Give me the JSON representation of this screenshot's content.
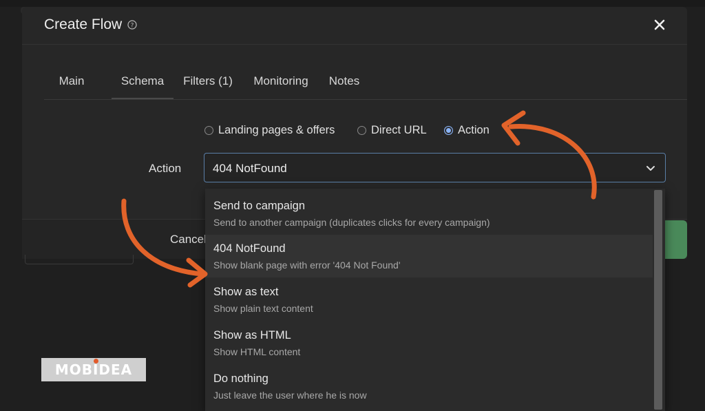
{
  "dialog": {
    "title": "Create Flow"
  },
  "tabs": [
    {
      "label": "Main"
    },
    {
      "label": "Schema"
    },
    {
      "label": "Filters (1)"
    },
    {
      "label": "Monitoring"
    },
    {
      "label": "Notes"
    }
  ],
  "active_tab": "Schema",
  "schema": {
    "radio_options": [
      {
        "label": "Landing pages & offers",
        "checked": false
      },
      {
        "label": "Direct URL",
        "checked": false
      },
      {
        "label": "Action",
        "checked": true
      }
    ],
    "action_label": "Action",
    "action_value": "404 NotFound"
  },
  "dropdown": {
    "options": [
      {
        "title": "Send to campaign",
        "desc": "Send to another campaign (duplicates clicks for every campaign)"
      },
      {
        "title": "404 NotFound",
        "desc": "Show blank page with error '404 Not Found'"
      },
      {
        "title": "Show as text",
        "desc": "Show plain text content"
      },
      {
        "title": "Show as HTML",
        "desc": "Show HTML content"
      },
      {
        "title": "Do nothing",
        "desc": "Just leave the user where he is now"
      }
    ],
    "highlighted_index": 1
  },
  "footer": {
    "cancel_label": "Cancel"
  },
  "watermark": {
    "text": "MOBIDEA"
  },
  "colors": {
    "accent": "#8ab4f8",
    "arrow": "#e2632a",
    "confirm": "#4a8a5a"
  }
}
